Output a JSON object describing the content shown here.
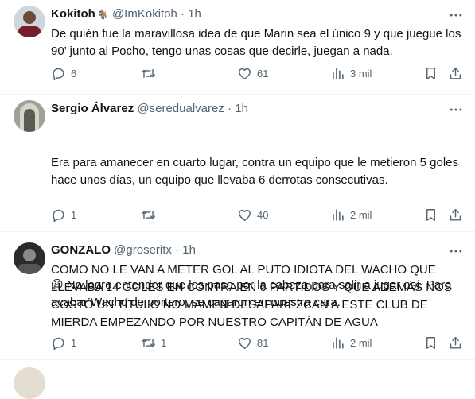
{
  "tweets": [
    {
      "name": "Kokitoh",
      "badge": "🐐",
      "handle": "@ImKokitoh",
      "separator": "·",
      "time": "1h",
      "text": "De quién fue la maravillosa idea de que Marin sea el único 9 y que juegue los 90’ junto al Pocho, tengo unas cosas que decirle, juegan a nada.",
      "replies": "6",
      "retweets": "",
      "likes": "61",
      "views": "3 mil"
    },
    {
      "name": "Sergio Álvarez",
      "handle": "@seredualvarez",
      "separator": "·",
      "time": "1h",
      "text_lines": [
        "Era para amanecer en cuarto lugar, contra un equipo que le metieron 5 goles hace unos días, un equipo que llevaba 6 derrotas consecutivas.",
        "",
        " No logro entender que les pasa por la cabeza para salir a jugar así. Para acabar Wacho de portero, se cagaron en nuestra cara."
      ],
      "emoji": "😩",
      "replies": "1",
      "retweets": "",
      "likes": "40",
      "views": "2 mil"
    },
    {
      "name": "GONZALO",
      "handle": "@groseritx",
      "separator": "·",
      "time": "1h",
      "text": "COMO NO LE VAN A METER GOL AL PUTO IDIOTA DEL WACHO QUE LLEVABA 14 GOLES EN CONTRA EN 6 PARTIDOS Y QUE ADEMÁS NOS COSTÓ UN TÍTULO NO MAMEN DESAPAREZCAN A ESTE CLUB DE MIERDA EMPEZANDO POR NUESTRO CAPITÁN DE AGUA",
      "replies": "1",
      "retweets": "1",
      "likes": "81",
      "views": "2 mil"
    }
  ],
  "icons": {
    "reply": "reply-icon",
    "retweet": "retweet-icon",
    "like": "like-icon",
    "views": "views-icon",
    "bookmark": "bookmark-icon",
    "share": "share-icon",
    "more": "more-icon"
  },
  "colors": {
    "text": "#0f1419",
    "secondary": "#536471",
    "border": "#eff3f4"
  }
}
